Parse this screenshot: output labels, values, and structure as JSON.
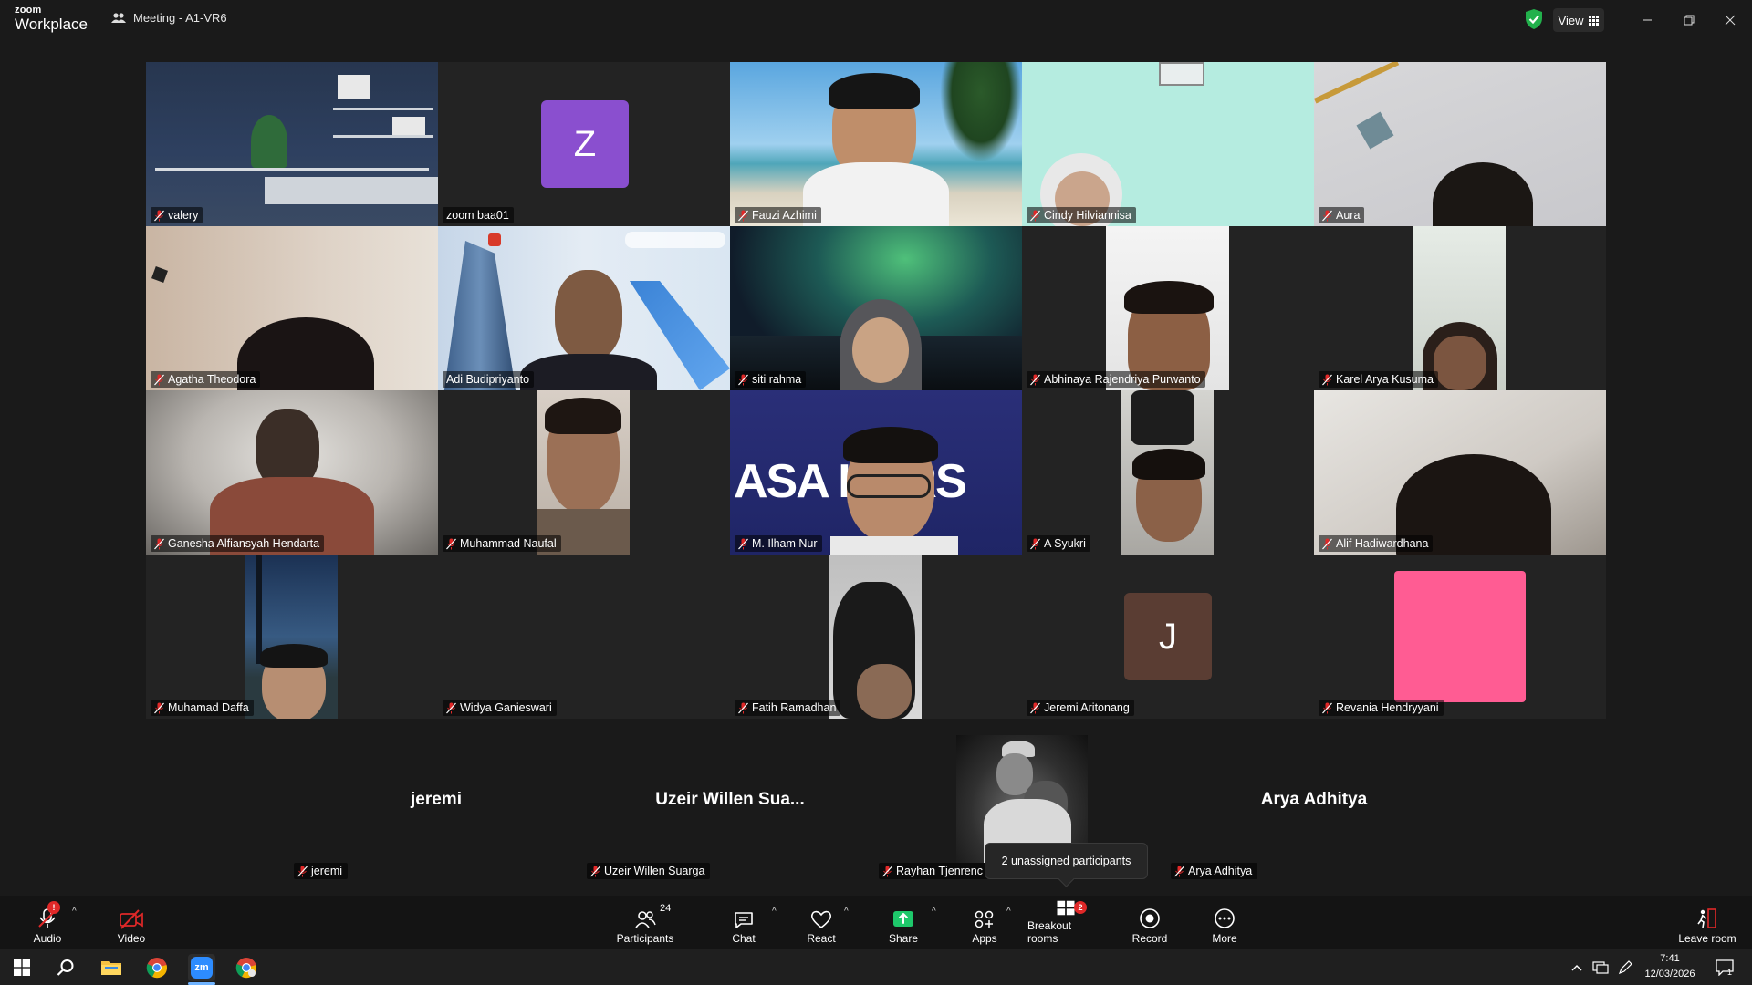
{
  "app": {
    "logo_small": "zoom",
    "logo_big": "Workplace",
    "meeting_title": "Meeting - A1-VR6",
    "view_label": "View"
  },
  "tiles": [
    {
      "name": "valery"
    },
    {
      "name": "zoom baa01",
      "avatar": "Z"
    },
    {
      "name": "Fauzi Azhimi"
    },
    {
      "name": "Cindy Hilviannisa"
    },
    {
      "name": "Aura"
    },
    {
      "name": "Agatha Theodora"
    },
    {
      "name": "Adi Budipriyanto"
    },
    {
      "name": "siti rahma"
    },
    {
      "name": "Abhinaya Rajendriya Purwanto"
    },
    {
      "name": "Karel Arya Kusuma"
    },
    {
      "name": "Ganesha Alfiansyah Hendarta"
    },
    {
      "name": "Muhammad Naufal"
    },
    {
      "name": "M. Ilham Nur"
    },
    {
      "name": "A Syukri"
    },
    {
      "name": "Alif Hadiwardhana"
    },
    {
      "name": "Muhamad Daffa"
    },
    {
      "name": "Widya Ganieswari"
    },
    {
      "name": "Fatih Ramadhan"
    },
    {
      "name": "Jeremi Aritonang",
      "avatar": "J"
    },
    {
      "name": "Revania Hendryyani"
    }
  ],
  "tile_overlay_text": "ASA KARS",
  "strip": [
    {
      "big": "jeremi",
      "label": "jeremi"
    },
    {
      "big": "Uzeir Willen Sua...",
      "label": "Uzeir Willen Suarga"
    },
    {
      "big": "",
      "label": "Rayhan Tjenrenc"
    },
    {
      "big": "Arya Adhitya",
      "label": "Arya Adhitya"
    }
  ],
  "tooltip": "2 unassigned participants",
  "toolbar": {
    "audio": "Audio",
    "video": "Video",
    "participants": "Participants",
    "participants_count": "24",
    "chat": "Chat",
    "react": "React",
    "share": "Share",
    "apps": "Apps",
    "breakout": "Breakout rooms",
    "breakout_badge": "2",
    "record": "Record",
    "more": "More",
    "leave": "Leave room"
  },
  "taskbar": {
    "time": "7:41",
    "date": "12/03/2026",
    "notif_count": "1",
    "zoom_icon_text": "zm"
  },
  "colors": {
    "active_speaker": "#23d9a5",
    "avatar_z": "#8a4fcf",
    "avatar_j": "#5a3d33",
    "avatar_pink": "#ff5c93",
    "share_green": "#1ec86b",
    "mute_red": "#e02828"
  }
}
